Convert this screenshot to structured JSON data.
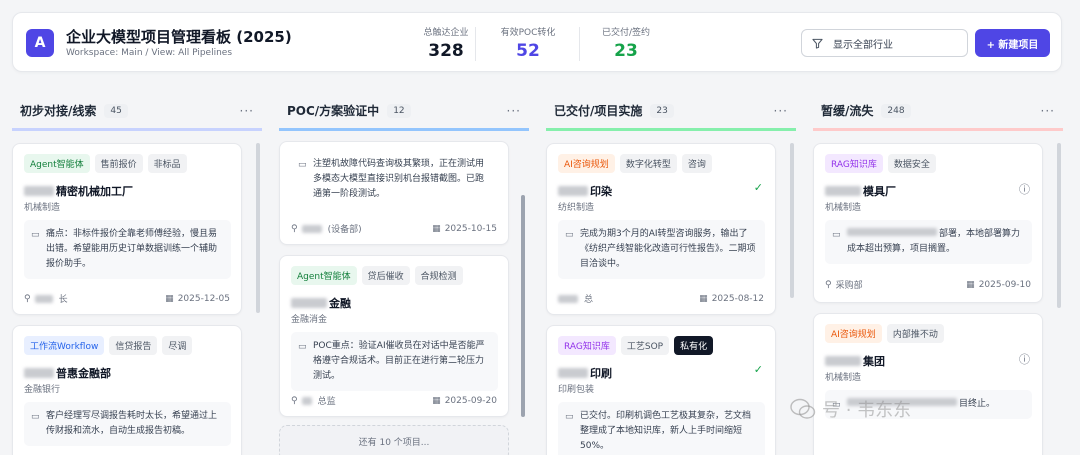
{
  "header": {
    "logo": "A",
    "title": "企业大模型项目管理看板 (2025)",
    "subtitle": "Workspace: Main / View: All Pipelines",
    "stats": [
      {
        "label": "总触达企业",
        "value": "328",
        "color": "#111827"
      },
      {
        "label": "有效POC转化",
        "value": "52",
        "color": "#4f46e5"
      },
      {
        "label": "已交付/签约",
        "value": "23",
        "color": "#16a34a"
      }
    ],
    "filter_label": "显示全部行业",
    "new_button": "+ 新建项目"
  },
  "columns": [
    {
      "title": "初步对接/线索",
      "count": "45",
      "accent": "#c7d2fe",
      "cards": [
        {
          "tags": [
            {
              "text": "Agent智能体",
              "kind": "agent"
            },
            {
              "text": "售前报价",
              "kind": ""
            },
            {
              "text": "非标品",
              "kind": ""
            }
          ],
          "company": "精密机械加工厂",
          "industry": "机械制造",
          "note": "痛点：非标件报价全靠老师傅经验，慢且易出错。希望能用历史订单数据训练一个辅助报价助手。",
          "owner": "长",
          "date": "2025-12-05"
        },
        {
          "tags": [
            {
              "text": "工作流Workflow",
              "kind": "workflow"
            },
            {
              "text": "信贷报告",
              "kind": ""
            },
            {
              "text": "尽调",
              "kind": ""
            }
          ],
          "company": "普惠金融部",
          "industry": "金融银行",
          "note": "客户经理写尽调报告耗时太长，希望通过上传财报和流水，自动生成报告初稿。"
        }
      ]
    },
    {
      "title": "POC/方案验证中",
      "count": "12",
      "accent": "#93c5fd",
      "cards": [
        {
          "note": "注塑机故障代码查询极其繁琐，正在测试用多模态大模型直接识别机台报错截图。已跑通第一阶段测试。",
          "owner": "(设备部)",
          "date": "2025-10-15"
        },
        {
          "tags": [
            {
              "text": "Agent智能体",
              "kind": "agent"
            },
            {
              "text": "贷后催收",
              "kind": ""
            },
            {
              "text": "合规检测",
              "kind": ""
            }
          ],
          "company": "金融",
          "industry": "金融消金",
          "note": "POC重点：验证AI催收员在对话中是否能严格遵守合规话术。目前正在进行第二轮压力测试。",
          "owner": "总监",
          "date": "2025-09-20"
        }
      ],
      "more_text": "还有 10 个项目..."
    },
    {
      "title": "已交付/项目实施",
      "count": "23",
      "accent": "#86efac",
      "cards": [
        {
          "tags": [
            {
              "text": "AI咨询规划",
              "kind": "aiconsult"
            },
            {
              "text": "数字化转型",
              "kind": ""
            },
            {
              "text": "咨询",
              "kind": ""
            }
          ],
          "company": "印染",
          "industry": "纺织制造",
          "status_icon": "✓",
          "note": "完成为期3个月的AI转型咨询服务，输出了《纺织产线智能化改造可行性报告》。二期项目洽谈中。",
          "owner": "总",
          "date": "2025-08-12"
        },
        {
          "tags": [
            {
              "text": "RAG知识库",
              "kind": "rag"
            },
            {
              "text": "工艺SOP",
              "kind": ""
            },
            {
              "text": "私有化",
              "kind": "dark"
            }
          ],
          "company": "印刷",
          "industry": "印刷包装",
          "status_icon": "✓",
          "note": "已交付。印刷机调色工艺极其复杂，艺文档整理成了本地知识库，新人上手时间缩短50%。"
        }
      ]
    },
    {
      "title": "暂缓/流失",
      "count": "248",
      "accent": "#fecaca",
      "cards": [
        {
          "tags": [
            {
              "text": "RAG知识库",
              "kind": "rag"
            },
            {
              "text": "数据安全",
              "kind": ""
            }
          ],
          "company": "模具厂",
          "industry": "机械制造",
          "status_icon": "ⓘ",
          "note": "部署，本地部署算力成本超出预算，项目搁置。",
          "owner": "采购部",
          "date": "2025-09-10"
        },
        {
          "tags": [
            {
              "text": "AI咨询规划",
              "kind": "aiconsult"
            },
            {
              "text": "内部推不动",
              "kind": ""
            }
          ],
          "company": "集团",
          "industry": "机械制造",
          "status_icon": "ⓘ",
          "note": "目终止。"
        }
      ]
    }
  ],
  "watermark": "号 · 韦东东"
}
